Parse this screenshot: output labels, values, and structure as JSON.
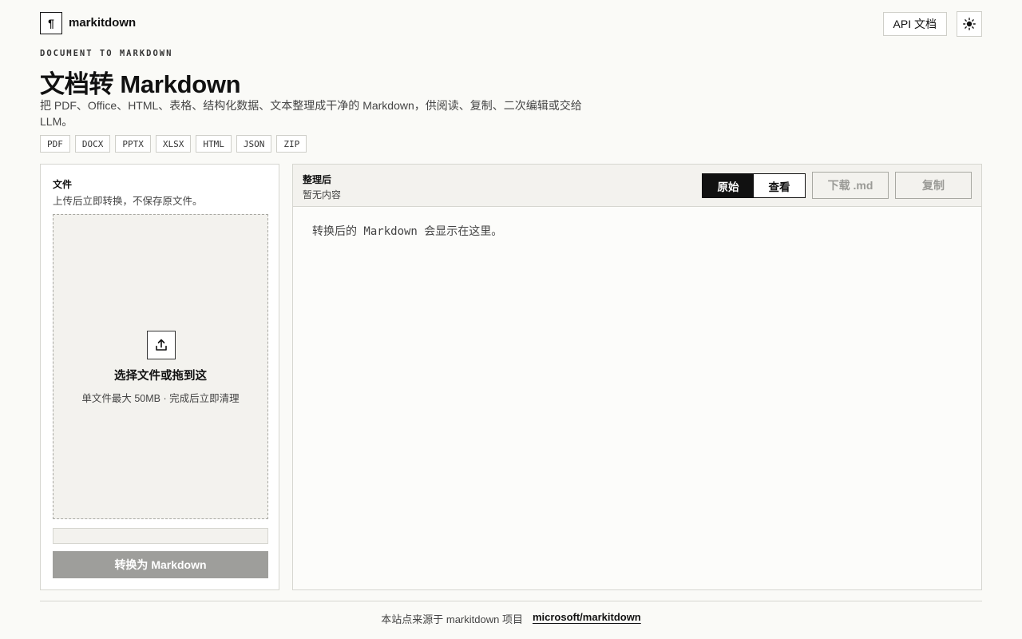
{
  "brand": {
    "name": "markitdown",
    "logo_glyph": "¶"
  },
  "header": {
    "api_docs_label": "API 文档",
    "theme_icon": "sun-icon"
  },
  "intro": {
    "eyebrow": "DOCUMENT TO MARKDOWN",
    "title": "文档转 Markdown",
    "description": "把 PDF、Office、HTML、表格、结构化数据、文本整理成干净的 Markdown，供阅读、复制、二次编辑或交给 LLM。",
    "formats": [
      "PDF",
      "DOCX",
      "PPTX",
      "XLSX",
      "HTML",
      "JSON",
      "ZIP"
    ]
  },
  "upload": {
    "title": "文件",
    "subtitle": "上传后立即转换，不保存原文件。",
    "dropzone_title": "选择文件或拖到这",
    "dropzone_hint": "单文件最大 50MB · 完成后立即清理",
    "progress": 0,
    "convert_label": "转换为 Markdown"
  },
  "output": {
    "title": "整理后",
    "status": "暂无内容",
    "tabs": [
      {
        "label": "原始",
        "active": true
      },
      {
        "label": "查看",
        "active": false
      }
    ],
    "download_label": "下载 .md",
    "copy_label": "复制",
    "placeholder": "转换后的 Markdown 会显示在这里。"
  },
  "footer": {
    "text": "本站点来源于 markitdown 项目",
    "link_label": "microsoft/markitdown"
  },
  "colors": {
    "accent": "#111111",
    "background": "#fafaf7",
    "disabled": "#9e9e9b"
  }
}
